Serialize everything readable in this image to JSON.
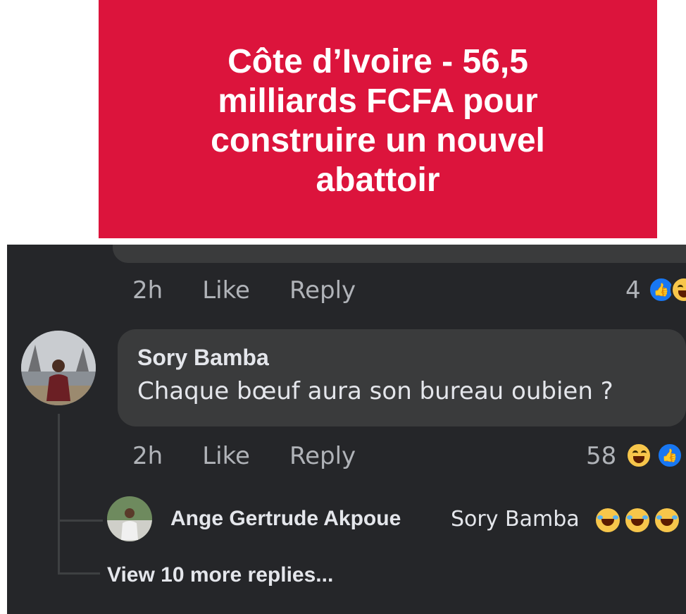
{
  "banner": {
    "title": "Côte d’Ivoire - 56,5 milliards FCFA pour construire un nouvel abattoir",
    "color": "#dc143c"
  },
  "comment_previous": {
    "time": "2h",
    "like_label": "Like",
    "reply_label": "Reply",
    "reaction_count": "4",
    "reactions": [
      "like-icon",
      "haha-icon"
    ]
  },
  "comment_main": {
    "author": "Sory Bamba",
    "text": "Chaque bœuf aura son bureau oubien ?",
    "time": "2h",
    "like_label": "Like",
    "reply_label": "Reply",
    "reaction_count": "58",
    "reactions": [
      "haha-icon",
      "like-icon"
    ]
  },
  "reply": {
    "author": "Ange Gertrude Akpoue",
    "mention": "Sory Bamba",
    "emojis": [
      "crying-laughing-emoji",
      "crying-laughing-emoji",
      "crying-laughing-emoji"
    ]
  },
  "view_more_label": "View 10 more replies..."
}
